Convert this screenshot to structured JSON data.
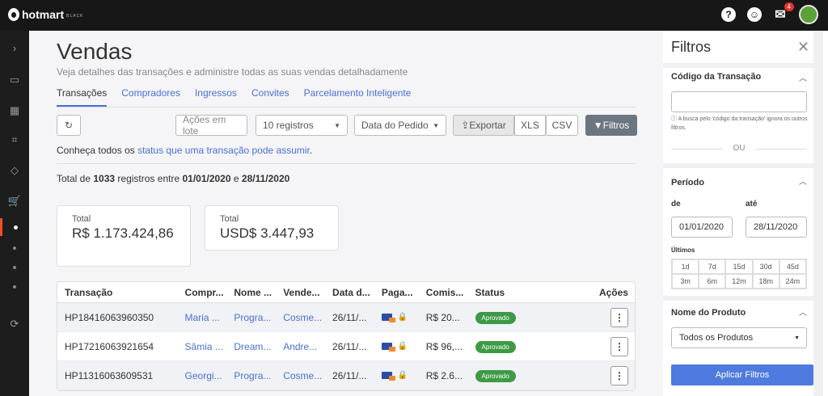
{
  "topbar": {
    "brand": "hotmart",
    "brand_tier": "BLACK",
    "help_icon": "?",
    "notification_count": "4"
  },
  "sidebar": {
    "expand_icon": "chevron-right-icon",
    "items": [
      "dashboard-icon",
      "grid-icon",
      "scan-icon",
      "box-icon",
      "cart-icon"
    ],
    "sync_icon": "sync-icon"
  },
  "page": {
    "title": "Vendas",
    "subtitle": "Veja detalhes das transações e administre todas as suas vendas detalhadamente",
    "tabs": [
      "Transações",
      "Compradores",
      "Ingressos",
      "Convites",
      "Parcelamento Inteligente"
    ],
    "active_tab": "Transações"
  },
  "toolbar": {
    "refresh_icon": "refresh-icon",
    "batch_actions": "Ações em lote",
    "records": "10 registros",
    "date_field": "Data do Pedido",
    "export": "Exportar",
    "xls": "XLS",
    "csv": "CSV",
    "filters": "Filtros"
  },
  "info": {
    "prefix": "Conheça todos os",
    "link": "status que uma transação pode assumir",
    "suffix": "."
  },
  "totals_line": {
    "t1": "Total de",
    "count": "1033",
    "t2": "registros entre",
    "start": "01/01/2020",
    "t3": "e",
    "end": "28/11/2020"
  },
  "cards": [
    {
      "label": "Total",
      "value": "R$ 1.173.424,86"
    },
    {
      "label": "Total",
      "value": "USD$ 3.447,93"
    }
  ],
  "table": {
    "headers": [
      "Transação",
      "Compr...",
      "Nome ...",
      "Vende...",
      "Data d...",
      "Paga...",
      "Comis...",
      "Status",
      "Ações"
    ],
    "rows": [
      {
        "id": "HP18416063960350",
        "buyer": "Maria ...",
        "product": "Progra...",
        "seller": "Cosme...",
        "date": "26/11/...",
        "commission": "R$ 20...",
        "status": "Aprovado"
      },
      {
        "id": "HP17216063921654",
        "buyer": "Sâmia ...",
        "product": "Dream...",
        "seller": "Andre...",
        "date": "26/11/...",
        "commission": "R$ 96,...",
        "status": "Aprovado"
      },
      {
        "id": "HP11316063609531",
        "buyer": "Georgi...",
        "product": "Progra...",
        "seller": "Cosme...",
        "date": "26/11/...",
        "commission": "R$ 2.6...",
        "status": "Aprovado"
      }
    ]
  },
  "filters_panel": {
    "title": "Filtros",
    "transaction_code": {
      "heading": "Código da Transação",
      "value": "",
      "note": "A busca pelo 'código da transação' ignora os outros filtros."
    },
    "or_label": "OU",
    "period": {
      "heading": "Período",
      "from_label": "de",
      "to_label": "até",
      "from_value": "01/01/2020",
      "to_value": "28/11/2020",
      "last_label": "Últimos",
      "quick_options": [
        "1d",
        "7d",
        "15d",
        "30d",
        "45d",
        "3m",
        "6m",
        "12m",
        "18m",
        "24m"
      ]
    },
    "product": {
      "heading": "Nome do Produto",
      "selected": "Todos os Produtos"
    },
    "apply": "Aplicar Filtros"
  }
}
